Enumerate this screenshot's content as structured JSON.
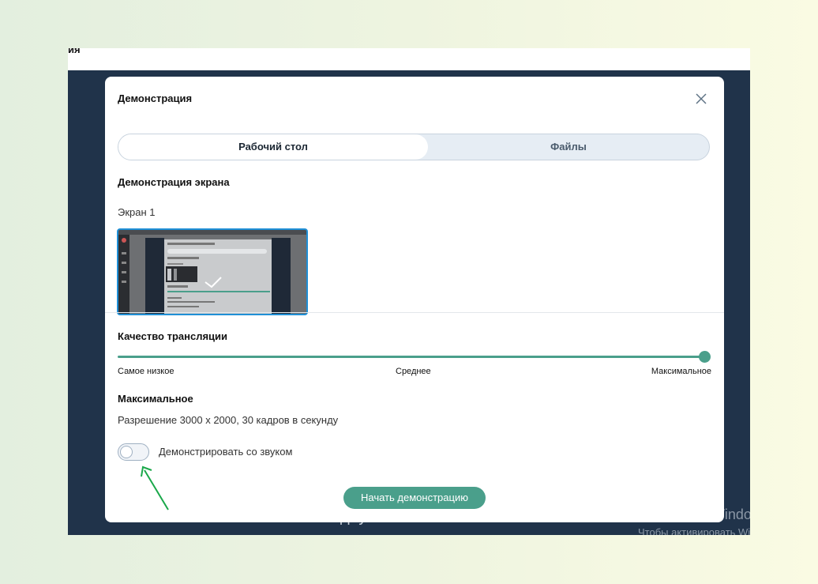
{
  "background": {
    "topbar_text": "ия",
    "participant_name": "Подлужная Анастасия",
    "watermark_title": "Активация Windows",
    "watermark_sub": "Чтобы активировать Windows"
  },
  "modal": {
    "title": "Демонстрация",
    "close_icon": "close-icon",
    "tabs": [
      {
        "label": "Рабочий стол",
        "active": true
      },
      {
        "label": "Файлы",
        "active": false
      }
    ],
    "screen_section_title": "Демонстрация экрана",
    "screen_label": "Экран 1",
    "quality_title": "Качество трансляции",
    "quality_levels": [
      "Самое низкое",
      "Среднее",
      "Максимальное"
    ],
    "quality_value_percent": 100,
    "selected_quality": "Максимальное",
    "resolution_text": "Разрешение 3000 x 2000, 30 кадров в секунду",
    "sound_toggle_label": "Демонстрировать со звуком",
    "sound_toggle_on": false,
    "start_button": "Начать демонстрацию"
  },
  "colors": {
    "accent": "#4a9f8b",
    "selection_border": "#1f8fd6",
    "arrow": "#1aa84a"
  }
}
